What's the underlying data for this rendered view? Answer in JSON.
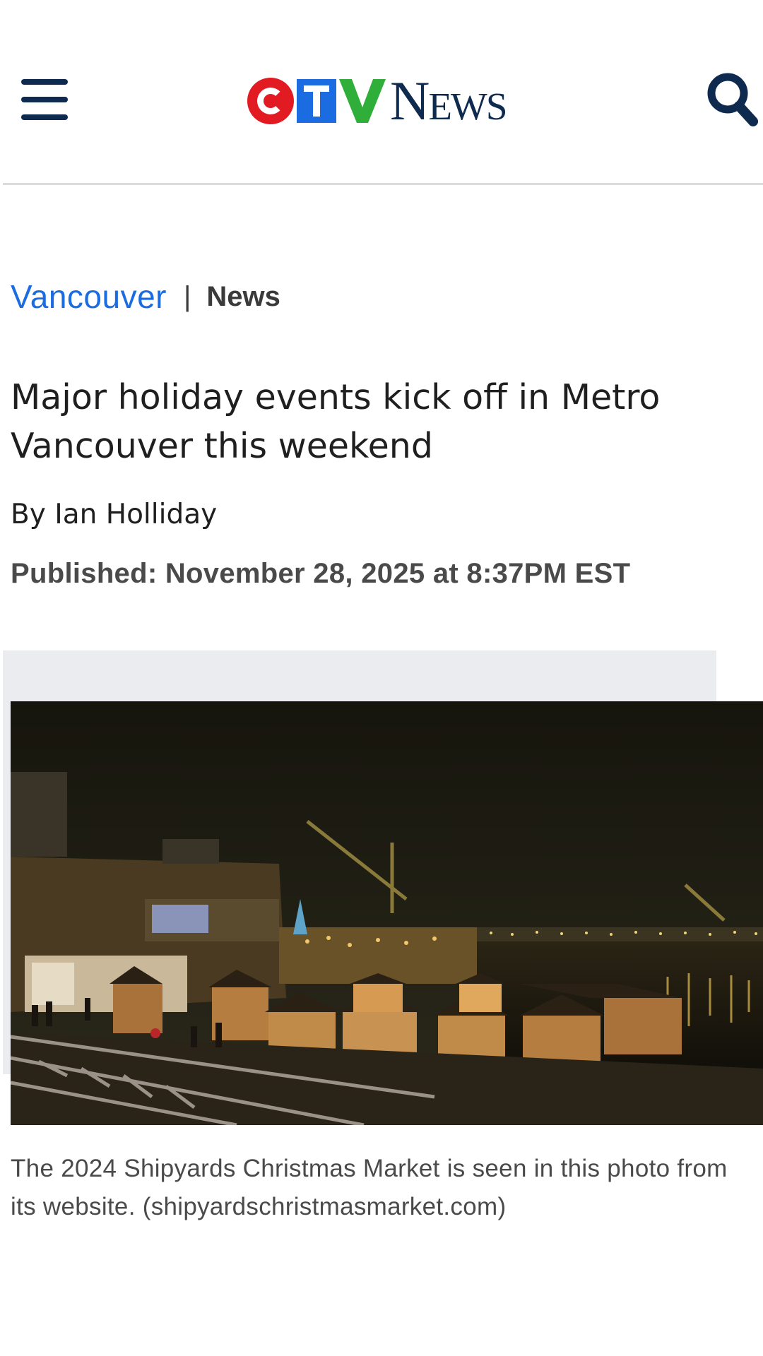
{
  "header": {
    "logo": {
      "ctv": "CTV",
      "news": "News"
    },
    "menu_icon": "hamburger-menu-icon",
    "search_icon": "search-icon"
  },
  "breadcrumb": {
    "section": "Vancouver",
    "separator": "|",
    "subsection": "News"
  },
  "article": {
    "title": "Major holiday events kick off in Metro Vancouver this weekend",
    "byline": "By Ian Holliday",
    "published": "Published: November 28, 2025 at 8:37PM EST",
    "caption": "The 2024 Shipyards Christmas Market is seen in this photo from its website. (shipyardschristmasmarket.com)"
  },
  "colors": {
    "brand_navy": "#0f2a4f",
    "brand_blue": "#1b6ce0",
    "brand_red": "#e21b23",
    "brand_green": "#2fae3a"
  }
}
